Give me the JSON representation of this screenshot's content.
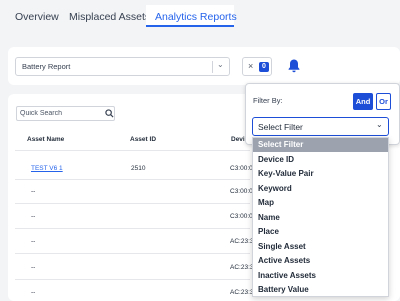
{
  "tabs": [
    "Overview",
    "Misplaced Assets",
    "Analytics Reports"
  ],
  "report_select": {
    "value": "Battery Report"
  },
  "clear_filter": {
    "x": "×",
    "count": "0"
  },
  "search": {
    "placeholder": "Quick Search"
  },
  "table": {
    "headers": [
      "Asset Name",
      "Asset ID",
      "Devi"
    ],
    "rows": [
      {
        "name": "TEST V6 1",
        "id": "2510",
        "device": "C3:00:0"
      },
      {
        "name": "--",
        "id": "",
        "device": "C3:00:0"
      },
      {
        "name": "--",
        "id": "",
        "device": "C3:00:0"
      },
      {
        "name": "--",
        "id": "",
        "device": "AC:23:3"
      },
      {
        "name": "--",
        "id": "",
        "device": "AC:23:3"
      },
      {
        "name": "--",
        "id": "",
        "device": "AC:23:3"
      }
    ]
  },
  "filter_panel": {
    "label": "Filter By:",
    "and_label": "And",
    "or_label": "Or",
    "select_value": "Select Filter",
    "options": [
      "Select Filter",
      "Device ID",
      "Key-Value Pair",
      "Keyword",
      "Map",
      "Name",
      "Place",
      "Single Asset",
      "Active Assets",
      "Inactive Assets",
      "Battery Value"
    ],
    "selected_index": 0
  },
  "colors": {
    "accent": "#1d4ed8",
    "link": "#2563eb",
    "selected_option": "#9ca3af"
  }
}
